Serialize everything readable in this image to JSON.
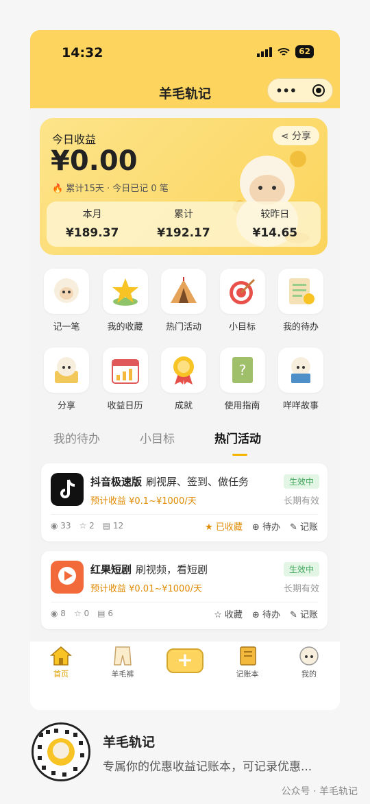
{
  "status": {
    "time": "14:32",
    "battery": "62"
  },
  "nav": {
    "title": "羊毛轨记",
    "more": "•••"
  },
  "earnings": {
    "label": "今日收益",
    "amount": "¥0.00",
    "sub": "累计15天 · 今日已记 0 笔",
    "share": "分享",
    "stats": [
      {
        "label": "本月",
        "value": "¥189.37"
      },
      {
        "label": "累计",
        "value": "¥192.17"
      },
      {
        "label": "较昨日",
        "value": "¥14.65"
      }
    ]
  },
  "grid": [
    {
      "label": "记一笔",
      "icon": "sheep-note-icon"
    },
    {
      "label": "我的收藏",
      "icon": "star-icon"
    },
    {
      "label": "热门活动",
      "icon": "tent-icon"
    },
    {
      "label": "小目标",
      "icon": "target-icon"
    },
    {
      "label": "我的待办",
      "icon": "checklist-icon"
    },
    {
      "label": "分享",
      "icon": "sheep-share-icon"
    },
    {
      "label": "收益日历",
      "icon": "calendar-icon"
    },
    {
      "label": "成就",
      "icon": "medal-icon"
    },
    {
      "label": "使用指南",
      "icon": "guide-book-icon"
    },
    {
      "label": "咩咩故事",
      "icon": "sheep-story-icon"
    }
  ],
  "tabs": [
    "我的待办",
    "小目标",
    "热门活动"
  ],
  "cards": [
    {
      "name": "抖音极速版",
      "desc": "刷视屏、签到、做任务",
      "earn": "预计收益 ¥0.1~¥1000/天",
      "badge": "生效中",
      "validity": "长期有效",
      "views": "33",
      "stars": "2",
      "records": "12",
      "fav": "已收藏",
      "todo": "待办",
      "account": "记账"
    },
    {
      "name": "红果短剧",
      "desc": "刷视频，看短剧",
      "earn": "预计收益 ¥0.01~¥1000/天",
      "badge": "生效中",
      "validity": "长期有效",
      "views": "8",
      "stars": "0",
      "records": "6",
      "fav": "收藏",
      "todo": "待办",
      "account": "记账"
    }
  ],
  "tabbar": [
    {
      "label": "首页",
      "icon": "home-icon"
    },
    {
      "label": "羊毛裤",
      "icon": "pants-icon"
    },
    {
      "label": "",
      "icon": "plus-icon"
    },
    {
      "label": "记账本",
      "icon": "notebook-icon"
    },
    {
      "label": "我的",
      "icon": "sheep-avatar-icon"
    }
  ],
  "footer": {
    "title": "羊毛轨记",
    "desc": "专属你的优惠收益记账本，可记录优惠...",
    "watermark": "公众号 · 羊毛轨记"
  },
  "colors": {
    "brand": "#fcd45e",
    "accent": "#e08a00",
    "active": "#3fa55a"
  }
}
